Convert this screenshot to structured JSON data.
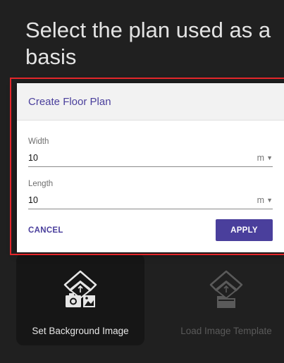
{
  "page": {
    "title": "Select the plan used as a basis"
  },
  "dialog": {
    "title": "Create Floor Plan",
    "width": {
      "label": "Width",
      "value": "10",
      "unit": "m"
    },
    "length": {
      "label": "Length",
      "value": "10",
      "unit": "m"
    },
    "cancel_label": "CANCEL",
    "apply_label": "APPLY",
    "accent_color": "#4a3f9c"
  },
  "options": [
    {
      "label": "Set Background Image",
      "icon": "camera-image-icon",
      "enabled": true
    },
    {
      "label": "Load Image Template",
      "icon": "folder-template-icon",
      "enabled": false
    }
  ],
  "highlight_color": "#e3262a"
}
